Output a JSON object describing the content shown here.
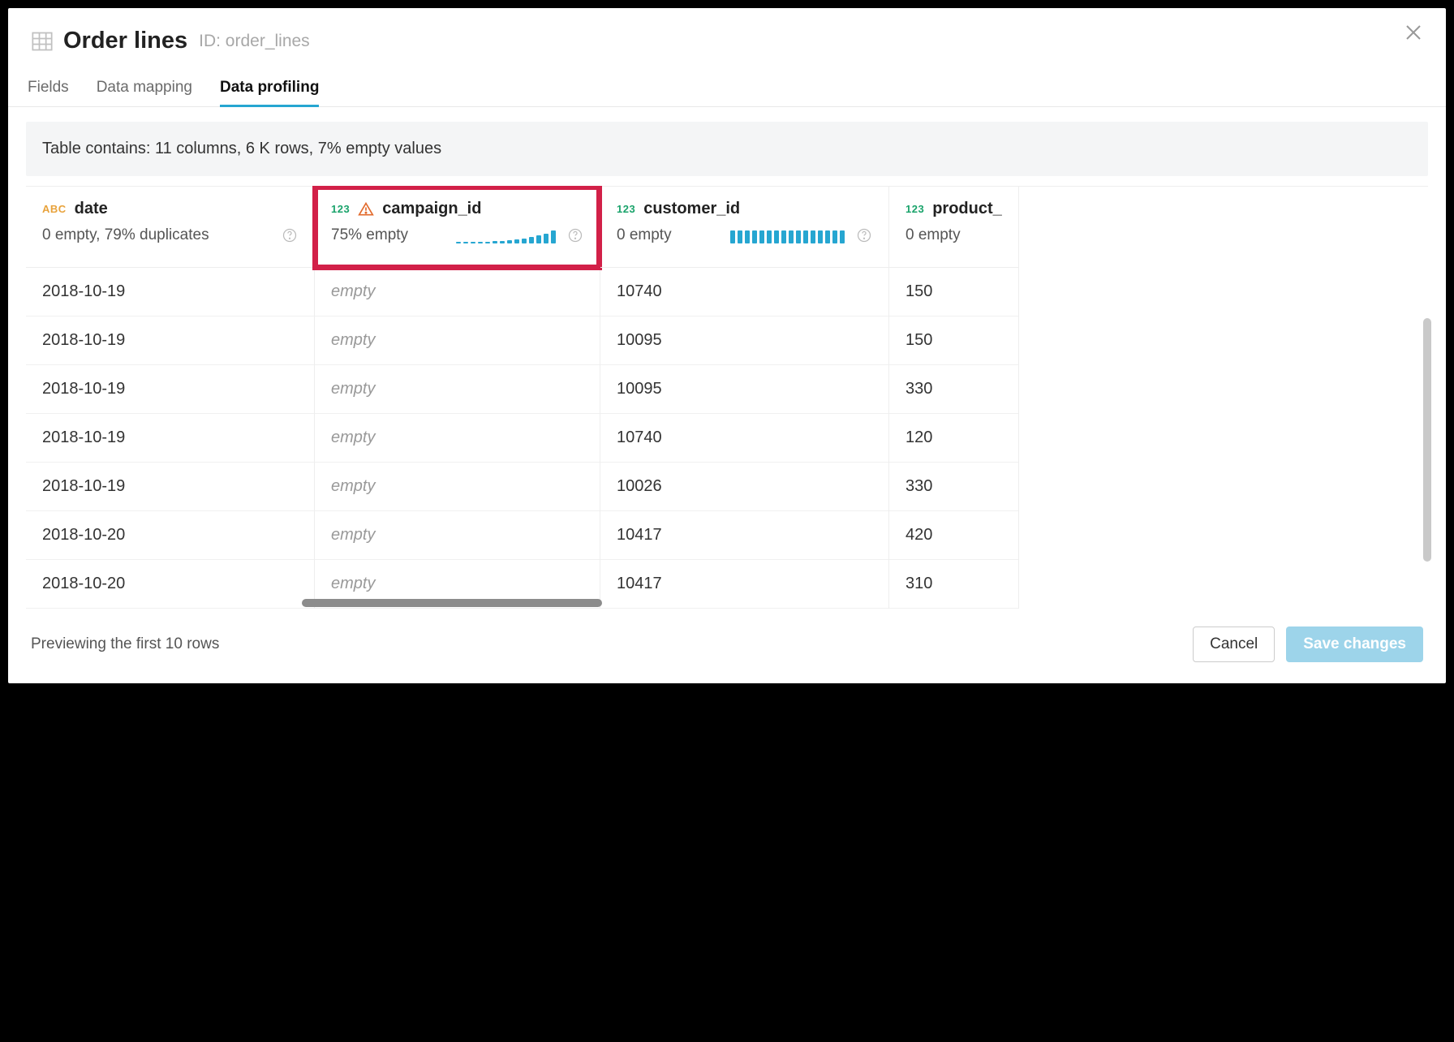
{
  "header": {
    "title": "Order lines",
    "id_label": "ID: order_lines"
  },
  "tabs": {
    "fields": "Fields",
    "mapping": "Data mapping",
    "profiling": "Data profiling"
  },
  "summary": "Table contains: 11 columns, 6 K rows, 7% empty values",
  "columns": [
    {
      "type_tag": "ABC",
      "type_class": "abc",
      "name": "date",
      "stats": "0 empty, 79% duplicates",
      "warn": false,
      "spark": null,
      "highlight": false
    },
    {
      "type_tag": "123",
      "type_class": "num",
      "name": "campaign_id",
      "stats": "75% empty",
      "warn": true,
      "spark": [
        2,
        2,
        2,
        2,
        2,
        3,
        3,
        4,
        5,
        6,
        8,
        10,
        12,
        16
      ],
      "highlight": true
    },
    {
      "type_tag": "123",
      "type_class": "num",
      "name": "customer_id",
      "stats": "0 empty",
      "warn": false,
      "spark": [
        16,
        16,
        16,
        16,
        16,
        16,
        16,
        16,
        16,
        16,
        16,
        16,
        16,
        16,
        16,
        16
      ],
      "highlight": false
    },
    {
      "type_tag": "123",
      "type_class": "num",
      "name": "product_",
      "stats": "0 empty",
      "warn": false,
      "spark": null,
      "highlight": false
    }
  ],
  "rows": [
    {
      "date": "2018-10-19",
      "campaign": "empty",
      "customer": "10740",
      "product": "150"
    },
    {
      "date": "2018-10-19",
      "campaign": "empty",
      "customer": "10095",
      "product": "150"
    },
    {
      "date": "2018-10-19",
      "campaign": "empty",
      "customer": "10095",
      "product": "330"
    },
    {
      "date": "2018-10-19",
      "campaign": "empty",
      "customer": "10740",
      "product": "120"
    },
    {
      "date": "2018-10-19",
      "campaign": "empty",
      "customer": "10026",
      "product": "330"
    },
    {
      "date": "2018-10-20",
      "campaign": "empty",
      "customer": "10417",
      "product": "420"
    },
    {
      "date": "2018-10-20",
      "campaign": "empty",
      "customer": "10417",
      "product": "310"
    }
  ],
  "empty_placeholder": "empty",
  "footer": {
    "preview": "Previewing the first 10 rows",
    "cancel": "Cancel",
    "save": "Save changes"
  }
}
